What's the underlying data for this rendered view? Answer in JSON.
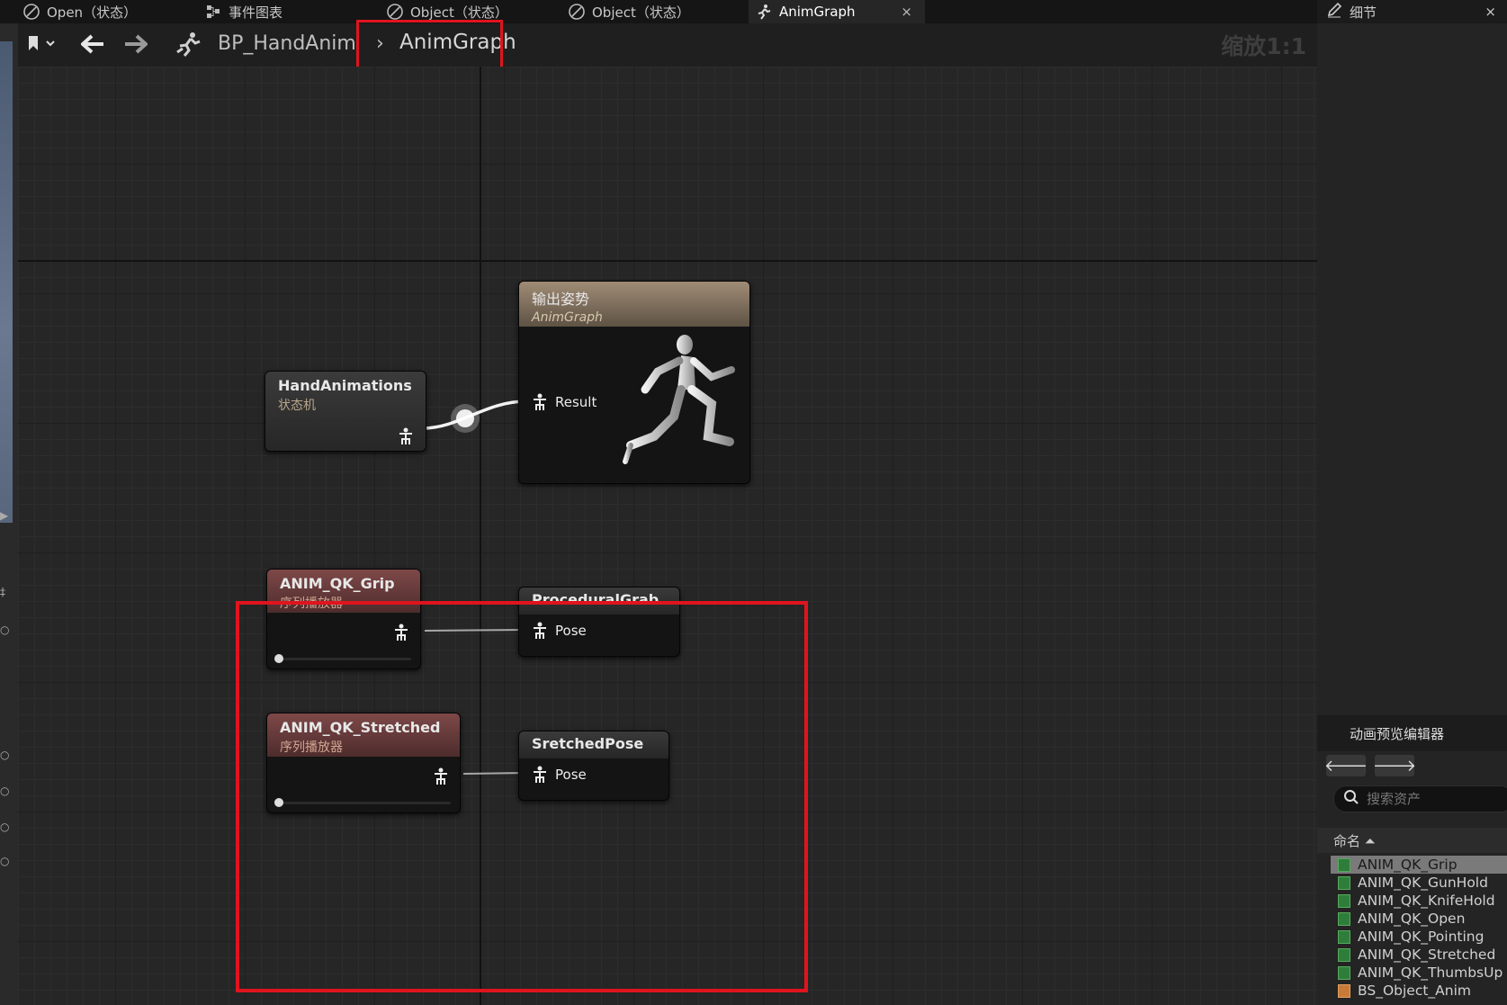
{
  "tabs": [
    {
      "label": "Open（状态）",
      "icon": "state-icon"
    },
    {
      "label": "事件图表",
      "icon": "event-graph-icon"
    },
    {
      "label": "Object（状态）",
      "icon": "state-icon"
    },
    {
      "label": "Object（状态）",
      "icon": "state-icon"
    },
    {
      "label": "AnimGraph",
      "icon": "animgraph-icon",
      "active": true,
      "close": "×"
    }
  ],
  "toolbar": {
    "breadcrumb_root": "BP_HandAnim",
    "breadcrumb_sep": "›",
    "breadcrumb_current": "AnimGraph",
    "zoom": "缩放1:1"
  },
  "nodes": {
    "output_pose": {
      "title": "输出姿势",
      "subtitle": "AnimGraph",
      "pin": "Result"
    },
    "hand_animations": {
      "title": "HandAnimations",
      "subtitle": "状态机"
    },
    "grip": {
      "title": "ANIM_QK_Grip",
      "subtitle": "序列播放器"
    },
    "procedural_grab": {
      "title": "ProceduralGrab",
      "pin": "Pose"
    },
    "stretched": {
      "title": "ANIM_QK_Stretched",
      "subtitle": "序列播放器"
    },
    "sretched_pose": {
      "title": "SretchedPose",
      "pin": "Pose"
    }
  },
  "right_panel": {
    "details_tab": "细节",
    "details_close": "×",
    "preview_editor_title": "动画预览编辑器",
    "search_placeholder": "搜索资产",
    "column_header": "命名 ⏶",
    "assets": [
      {
        "name": "ANIM_QK_Grip",
        "selected": true,
        "type": "anim"
      },
      {
        "name": "ANIM_QK_GunHold",
        "type": "anim"
      },
      {
        "name": "ANIM_QK_KnifeHold",
        "type": "anim"
      },
      {
        "name": "ANIM_QK_Open",
        "type": "anim"
      },
      {
        "name": "ANIM_QK_Pointing",
        "type": "anim"
      },
      {
        "name": "ANIM_QK_Stretched",
        "type": "anim"
      },
      {
        "name": "ANIM_QK_ThumbsUp",
        "type": "anim"
      },
      {
        "name": "BS_Object_Anim",
        "type": "blendspace"
      }
    ]
  },
  "colors": {
    "highlight": "#e0141e",
    "state_machine_header": "#3a3a3a",
    "output_header": "#7a6a58",
    "sequence_header": "#6a3a3a"
  }
}
